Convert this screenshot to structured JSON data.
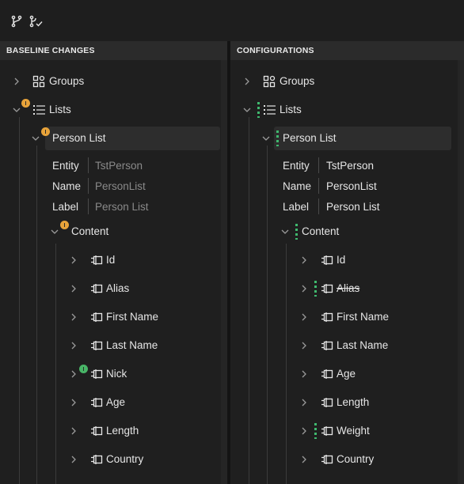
{
  "toolbar": {
    "icons": [
      "branch-icon",
      "branch-check-icon"
    ]
  },
  "baseline": {
    "header": "BASELINE CHANGES",
    "groups_label": "Groups",
    "lists_label": "Lists",
    "person_list_label": "Person List",
    "props": [
      {
        "name": "Entity",
        "value": "TstPerson"
      },
      {
        "name": "Name",
        "value": "PersonList"
      },
      {
        "name": "Label",
        "value": "Person List"
      }
    ],
    "content_label": "Content",
    "fields": [
      "Id",
      "Alias",
      "First Name",
      "Last Name",
      "Nick",
      "Age",
      "Length",
      "Country"
    ]
  },
  "configurations": {
    "header": "CONFIGURATIONS",
    "groups_label": "Groups",
    "lists_label": "Lists",
    "person_list_label": "Person List",
    "props": [
      {
        "name": "Entity",
        "value": "TstPerson"
      },
      {
        "name": "Name",
        "value": "PersonList"
      },
      {
        "name": "Label",
        "value": "Person List"
      }
    ],
    "content_label": "Content",
    "fields": [
      "Id",
      "Alias",
      "First Name",
      "Last Name",
      "Age",
      "Length",
      "Weight",
      "Country"
    ]
  },
  "colors": {
    "modified_badge": "#e8a33a",
    "added_badge": "#48b567",
    "change_marker": "#3fb96e"
  }
}
